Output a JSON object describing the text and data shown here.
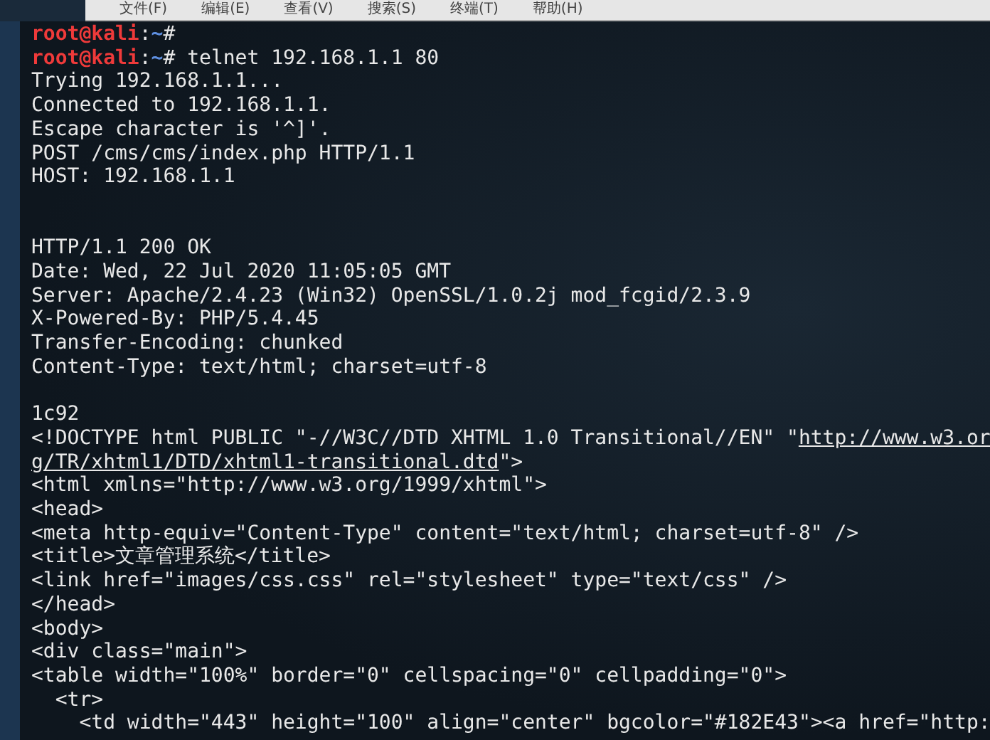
{
  "menu": [
    {
      "label": "文件(F)"
    },
    {
      "label": "编辑(E)"
    },
    {
      "label": "查看(V)"
    },
    {
      "label": "搜索(S)"
    },
    {
      "label": "终端(T)"
    },
    {
      "label": "帮助(H)"
    }
  ],
  "lines": [
    {
      "kind": "prompt",
      "parts": [
        {
          "kind": "user",
          "text": "root@kali"
        },
        {
          "kind": "plain",
          "text": ":"
        },
        {
          "kind": "path",
          "text": "~"
        },
        {
          "kind": "plain",
          "text": "#"
        }
      ]
    },
    {
      "kind": "prompt",
      "parts": [
        {
          "kind": "user",
          "text": "root@kali"
        },
        {
          "kind": "plain",
          "text": ":"
        },
        {
          "kind": "path",
          "text": "~"
        },
        {
          "kind": "plain",
          "text": "# telnet 192.168.1.1 80"
        }
      ]
    },
    {
      "kind": "text",
      "text": "Trying 192.168.1.1..."
    },
    {
      "kind": "text",
      "text": "Connected to 192.168.1.1."
    },
    {
      "kind": "text",
      "text": "Escape character is '^]'."
    },
    {
      "kind": "text",
      "text": "POST /cms/cms/index.php HTTP/1.1"
    },
    {
      "kind": "text",
      "text": "HOST: 192.168.1.1"
    },
    {
      "kind": "blank"
    },
    {
      "kind": "blank"
    },
    {
      "kind": "text",
      "text": "HTTP/1.1 200 OK"
    },
    {
      "kind": "text",
      "text": "Date: Wed, 22 Jul 2020 11:05:05 GMT"
    },
    {
      "kind": "text",
      "text": "Server: Apache/2.4.23 (Win32) OpenSSL/1.0.2j mod_fcgid/2.3.9"
    },
    {
      "kind": "text",
      "text": "X-Powered-By: PHP/5.4.45"
    },
    {
      "kind": "text",
      "text": "Transfer-Encoding: chunked"
    },
    {
      "kind": "text",
      "text": "Content-Type: text/html; charset=utf-8"
    },
    {
      "kind": "blank"
    },
    {
      "kind": "text",
      "text": "1c92"
    },
    {
      "kind": "link",
      "before": "<!DOCTYPE html PUBLIC \"-//W3C//DTD XHTML 1.0 Transitional//EN\" \"",
      "link": "http://www.w3.or"
    },
    {
      "kind": "link",
      "link": "g/TR/xhtml1/DTD/xhtml1-transitional.dtd",
      "after": "\">"
    },
    {
      "kind": "text",
      "text": "<html xmlns=\"http://www.w3.org/1999/xhtml\">"
    },
    {
      "kind": "text",
      "text": "<head>"
    },
    {
      "kind": "text",
      "text": "<meta http-equiv=\"Content-Type\" content=\"text/html; charset=utf-8\" />"
    },
    {
      "kind": "text",
      "text": "<title>文章管理系统</title>"
    },
    {
      "kind": "text",
      "text": "<link href=\"images/css.css\" rel=\"stylesheet\" type=\"text/css\" />"
    },
    {
      "kind": "text",
      "text": "</head>"
    },
    {
      "kind": "text",
      "text": "<body>"
    },
    {
      "kind": "text",
      "text": "<div class=\"main\">"
    },
    {
      "kind": "text",
      "text": "<table width=\"100%\" border=\"0\" cellspacing=\"0\" cellpadding=\"0\">"
    },
    {
      "kind": "text",
      "text": "  <tr>"
    },
    {
      "kind": "text",
      "text": "    <td width=\"443\" height=\"100\" align=\"center\" bgcolor=\"#182E43\"><a href=\"http:"
    }
  ]
}
